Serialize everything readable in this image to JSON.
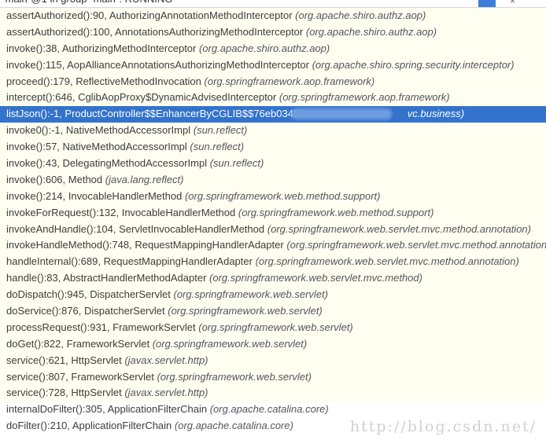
{
  "frames": [
    {
      "method": "assertAuthorized():90,",
      "cls": "AuthorizingAnnotationMethodInterceptor",
      "pkg": "(org.apache.shiro.authz.aop)",
      "kind": "app"
    },
    {
      "method": "assertAuthorized():100,",
      "cls": "AnnotationsAuthorizingMethodInterceptor",
      "pkg": "(org.apache.shiro.authz.aop)",
      "kind": "app"
    },
    {
      "method": "invoke():38,",
      "cls": "AuthorizingMethodInterceptor",
      "pkg": "(org.apache.shiro.authz.aop)",
      "kind": "app"
    },
    {
      "method": "invoke():115,",
      "cls": "AopAllianceAnnotationsAuthorizingMethodInterceptor",
      "pkg": "(org.apache.shiro.spring.security.interceptor)",
      "kind": "app"
    },
    {
      "method": "proceed():179,",
      "cls": "ReflectiveMethodInvocation",
      "pkg": "(org.springframework.aop.framework)",
      "kind": "app"
    },
    {
      "method": "intercept():646,",
      "cls": "CglibAopProxy$DynamicAdvisedInterceptor",
      "pkg": "(org.springframework.aop.framework)",
      "kind": "app"
    },
    {
      "method": "listJson():-1,",
      "cls": "ProductController$$EnhancerByCGLIB$$76eb0343",
      "pkg": "vc.business)",
      "kind": "selected"
    },
    {
      "method": "invoke0():-1,",
      "cls": "NativeMethodAccessorImpl",
      "pkg": "(sun.reflect)",
      "kind": "app"
    },
    {
      "method": "invoke():57,",
      "cls": "NativeMethodAccessorImpl",
      "pkg": "(sun.reflect)",
      "kind": "app"
    },
    {
      "method": "invoke():43,",
      "cls": "DelegatingMethodAccessorImpl",
      "pkg": "(sun.reflect)",
      "kind": "app"
    },
    {
      "method": "invoke():606,",
      "cls": "Method",
      "pkg": "(java.lang.reflect)",
      "kind": "app"
    },
    {
      "method": "invoke():214,",
      "cls": "InvocableHandlerMethod",
      "pkg": "(org.springframework.web.method.support)",
      "kind": "app"
    },
    {
      "method": "invokeForRequest():132,",
      "cls": "InvocableHandlerMethod",
      "pkg": "(org.springframework.web.method.support)",
      "kind": "app"
    },
    {
      "method": "invokeAndHandle():104,",
      "cls": "ServletInvocableHandlerMethod",
      "pkg": "(org.springframework.web.servlet.mvc.method.annotation)",
      "kind": "app"
    },
    {
      "method": "invokeHandleMethod():748,",
      "cls": "RequestMappingHandlerAdapter",
      "pkg": "(org.springframework.web.servlet.mvc.method.annotation)",
      "kind": "app"
    },
    {
      "method": "handleInternal():689,",
      "cls": "RequestMappingHandlerAdapter",
      "pkg": "(org.springframework.web.servlet.mvc.method.annotation)",
      "kind": "app"
    },
    {
      "method": "handle():83,",
      "cls": "AbstractHandlerMethodAdapter",
      "pkg": "(org.springframework.web.servlet.mvc.method)",
      "kind": "app"
    },
    {
      "method": "doDispatch():945,",
      "cls": "DispatcherServlet",
      "pkg": "(org.springframework.web.servlet)",
      "kind": "app"
    },
    {
      "method": "doService():876,",
      "cls": "DispatcherServlet",
      "pkg": "(org.springframework.web.servlet)",
      "kind": "app"
    },
    {
      "method": "processRequest():931,",
      "cls": "FrameworkServlet",
      "pkg": "(org.springframework.web.servlet)",
      "kind": "app"
    },
    {
      "method": "doGet():822,",
      "cls": "FrameworkServlet",
      "pkg": "(org.springframework.web.servlet)",
      "kind": "app"
    },
    {
      "method": "service():621,",
      "cls": "HttpServlet",
      "pkg": "(javax.servlet.http)",
      "kind": "app"
    },
    {
      "method": "service():807,",
      "cls": "FrameworkServlet",
      "pkg": "(org.springframework.web.servlet)",
      "kind": "app"
    },
    {
      "method": "service():728,",
      "cls": "HttpServlet",
      "pkg": "(javax.servlet.http)",
      "kind": "app"
    },
    {
      "method": "internalDoFilter():305,",
      "cls": "ApplicationFilterChain",
      "pkg": "(org.apache.catalina.core)",
      "kind": "library"
    },
    {
      "method": "doFilter():210,",
      "cls": "ApplicationFilterChain",
      "pkg": "(org.apache.catalina.core)",
      "kind": "library"
    }
  ],
  "watermark": "http://blog.csdn.net/",
  "colors": {
    "selection": "#3373cc",
    "app_frame_bg": "#fefef1",
    "library_frame_bg": "#ffffff",
    "package_text": "#55555c"
  }
}
